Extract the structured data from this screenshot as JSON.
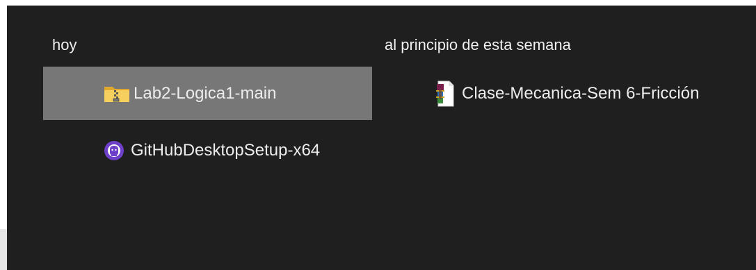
{
  "groups": [
    {
      "header": "hoy",
      "items": [
        {
          "name": "Lab2-Logica1-main",
          "icon": "zip-folder-icon",
          "selected": true
        },
        {
          "name": "GitHubDesktopSetup-x64",
          "icon": "github-desktop-icon",
          "selected": false
        }
      ]
    },
    {
      "header": "al principio de esta semana",
      "items": [
        {
          "name": "Clase-Mecanica-Sem 6-Fricción",
          "icon": "winrar-archive-icon",
          "selected": false
        }
      ]
    }
  ],
  "colors": {
    "background": "#1f1f1f",
    "selected_background": "#777777",
    "text": "#ececec",
    "github_purple": "#6e40c9",
    "folder_yellow": "#f2c94c"
  }
}
